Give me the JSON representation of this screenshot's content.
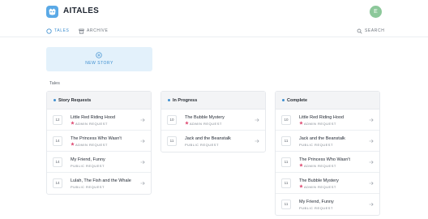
{
  "app": {
    "brand": "AITALES",
    "avatar_initial": "E"
  },
  "nav": {
    "tabs": [
      {
        "label": "TALES",
        "active": true
      },
      {
        "label": "ARCHIVE",
        "active": false
      }
    ],
    "search_label": "SEARCH"
  },
  "new_story": {
    "label": "NEW STORY"
  },
  "section_title": "Tales",
  "colors": {
    "accent": "#3e8fd0",
    "admin_star": "#e0547a"
  },
  "columns": [
    {
      "title": "Story Requests",
      "cards": [
        {
          "num": "12",
          "name": "Little Red Riding Hood",
          "tag": "ADMIN REQUEST",
          "admin": true
        },
        {
          "num": "14",
          "name": "The Princess Who Wasn't",
          "tag": "ADMIN REQUEST",
          "admin": true
        },
        {
          "num": "14",
          "name": "My Friend, Funny",
          "tag": "PUBLIC REQUEST",
          "admin": false
        },
        {
          "num": "14",
          "name": "Lulah, The Fish and the Whale",
          "tag": "PUBLIC REQUEST",
          "admin": false
        }
      ]
    },
    {
      "title": "In Progress",
      "cards": [
        {
          "num": "10",
          "name": "The Bubble Mystery",
          "tag": "ADMIN REQUEST",
          "admin": true
        },
        {
          "num": "11",
          "name": "Jack and the Beanstalk",
          "tag": "PUBLIC REQUEST",
          "admin": false
        }
      ]
    },
    {
      "title": "Complete",
      "cards": [
        {
          "num": "10",
          "name": "Little Red Riding Hood",
          "tag": "ADMIN REQUEST",
          "admin": true
        },
        {
          "num": "11",
          "name": "Jack and the Beanstalk",
          "tag": "PUBLIC REQUEST",
          "admin": false
        },
        {
          "num": "11",
          "name": "The Princess Who Wasn't",
          "tag": "ADMIN REQUEST",
          "admin": true
        },
        {
          "num": "11",
          "name": "The Bubble Mystery",
          "tag": "ADMIN REQUEST",
          "admin": true
        },
        {
          "num": "11",
          "name": "My Friend, Funny",
          "tag": "PUBLIC REQUEST",
          "admin": false
        }
      ]
    }
  ]
}
